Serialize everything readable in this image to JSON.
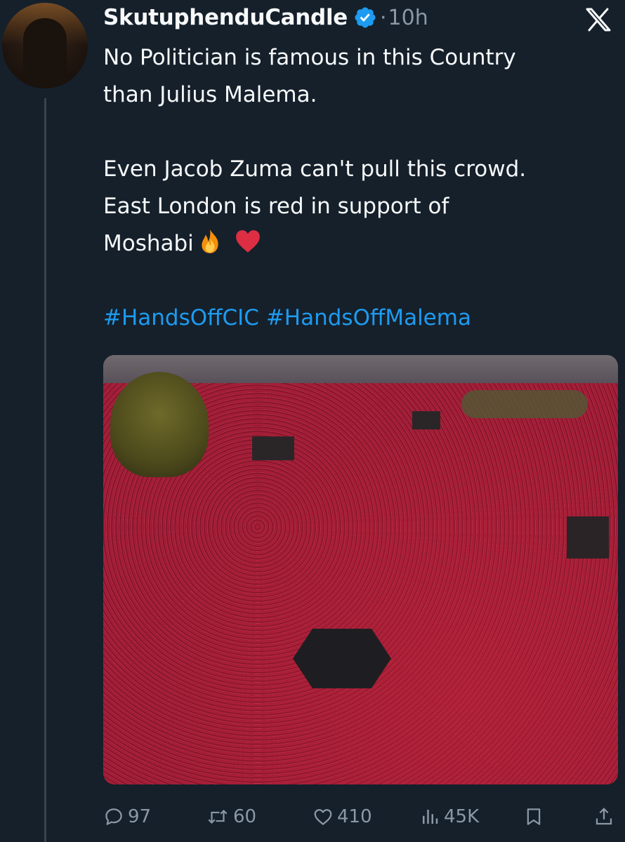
{
  "post": {
    "author": {
      "display_name": "SkutuphenduCandle",
      "verified": true
    },
    "separator": "·",
    "time_ago": "10h",
    "text_lines": [
      "No Politician is famous in this Country",
      "than Julius Malema.",
      "Even Jacob Zuma can't pull this crowd.",
      "East London is red in support of",
      "Moshabi"
    ],
    "emojis": [
      "fire",
      "red-heart"
    ],
    "hashtags": [
      "#HandsOffCIC",
      "#HandsOffMalema"
    ],
    "hashtags_text": "#HandsOffCIC #HandsOffMalema"
  },
  "metrics": {
    "replies": "97",
    "reposts": "60",
    "likes": "410",
    "views": "45K"
  },
  "colors": {
    "background": "#15202b",
    "text": "#f7f9f9",
    "muted": "#8b98a5",
    "link": "#1d9bf0",
    "verified_badge": "#1d9bf0"
  },
  "icons": {
    "reply": "reply-icon",
    "repost": "repost-icon",
    "like": "heart-icon",
    "views": "views-icon",
    "bookmark": "bookmark-icon",
    "share": "share-icon",
    "brand": "x-logo-icon"
  }
}
